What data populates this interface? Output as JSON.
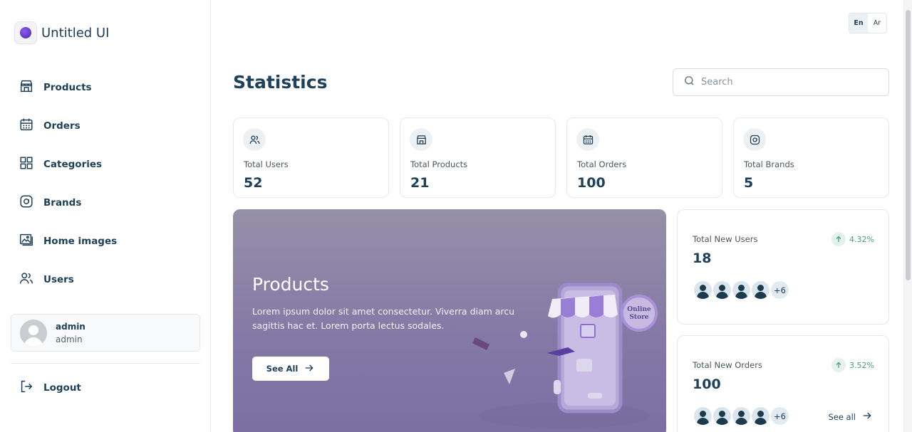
{
  "app": {
    "name": "Untitled UI"
  },
  "sidebar": {
    "items": [
      {
        "label": "Products",
        "icon": "store-icon"
      },
      {
        "label": "Orders",
        "icon": "calendar-icon"
      },
      {
        "label": "Categories",
        "icon": "grid-icon"
      },
      {
        "label": "Brands",
        "icon": "brand-icon"
      },
      {
        "label": "Home images",
        "icon": "images-icon"
      },
      {
        "label": "Users",
        "icon": "users-icon"
      }
    ],
    "profile": {
      "name": "admin",
      "role": "admin"
    },
    "logout_label": "Logout"
  },
  "header": {
    "lang_en": "En",
    "lang_ar": "Ar",
    "title": "Statistics",
    "search_placeholder": "Search"
  },
  "stats": [
    {
      "label": "Total Users",
      "value": "52",
      "icon": "users-icon"
    },
    {
      "label": "Total Products",
      "value": "21",
      "icon": "store-icon"
    },
    {
      "label": "Total Orders",
      "value": "100",
      "icon": "calendar-icon"
    },
    {
      "label": "Total Brands",
      "value": "5",
      "icon": "brand-icon"
    }
  ],
  "banner": {
    "title": "Products",
    "text": "Lorem ipsum dolor sit amet consectetur. Viverra diam arcu sagittis hac et. Lorem porta lectus sodales.",
    "button_label": "See All",
    "sign_line1": "Online",
    "sign_line2": "Store"
  },
  "new_users": {
    "label": "Total New Users",
    "value": "18",
    "trend": "4.32%",
    "more": "+6"
  },
  "new_orders": {
    "label": "Total New Orders",
    "value": "100",
    "trend": "3.52%",
    "more": "+6",
    "see_all": "See all"
  },
  "colors": {
    "accent": "#1f4059",
    "trend": "#4d9a82",
    "banner": "#8479a6"
  }
}
